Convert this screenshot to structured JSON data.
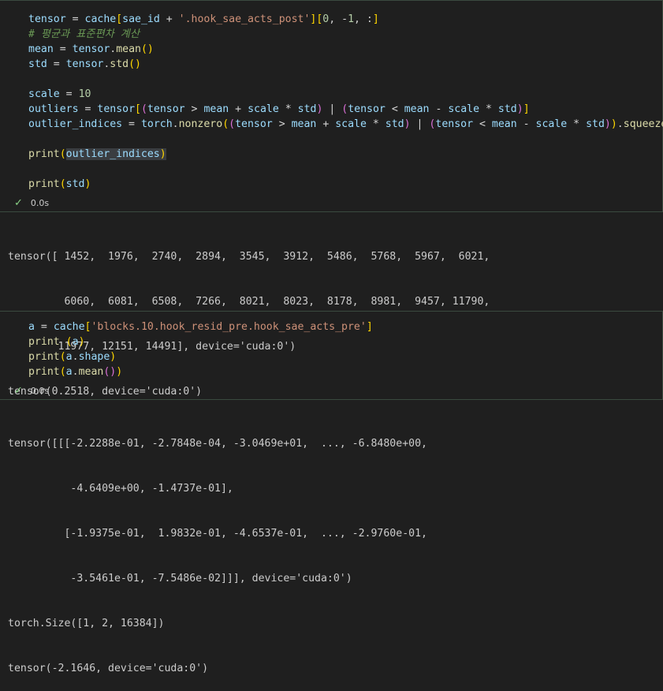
{
  "cell1": {
    "lines": [
      "tensor = cache[sae_id + '.hook_sae_acts_post'][0, -1, :]",
      "# 평균과 표준편차 계산",
      "mean = tensor.mean()",
      "std = tensor.std()",
      "",
      "scale = 10",
      "outliers = tensor[(tensor > mean + scale * std) | (tensor < mean - scale * std)]",
      "outlier_indices = torch.nonzero((tensor > mean + scale * std) | (tensor < mean - scale * std)).squeeze()",
      "",
      "print(outlier_indices)",
      "",
      "print(std)"
    ],
    "status": {
      "check": "✓",
      "time": "0.0s"
    },
    "output": [
      "tensor([ 1452,  1976,  2740,  2894,  3545,  3912,  5486,  5768,  5967,  6021,",
      "         6060,  6081,  6508,  7266,  8021,  8023,  8178,  8981,  9457, 11790,",
      "        11977, 12151, 14491], device='cuda:0')",
      "tensor(0.2518, device='cuda:0')"
    ]
  },
  "cell2": {
    "lines": [
      "a = cache['blocks.10.hook_resid_pre.hook_sae_acts_pre']",
      "print (a)",
      "print(a.shape)",
      "print(a.mean())"
    ],
    "status": {
      "check": "✓",
      "time": "0.0s"
    },
    "output": [
      "tensor([[[-2.2288e-01, -2.7848e-04, -3.0469e+01,  ..., -6.8480e+00,",
      "          -4.6409e+00, -1.4737e-01],",
      "         [-1.9375e-01,  1.9832e-01, -4.6537e-01,  ..., -2.9760e-01,",
      "          -3.5461e-01, -7.5486e-02]]], device='cuda:0')",
      "torch.Size([1, 2, 16384])",
      "tensor(-2.1646, device='cuda:0')"
    ]
  },
  "colors": {
    "background": "#1f1f1f",
    "variable": "#9cdcfe",
    "function": "#dcdcaa",
    "string": "#ce9178",
    "number": "#b5cea8",
    "comment": "#6a9955",
    "success": "#89d185"
  }
}
